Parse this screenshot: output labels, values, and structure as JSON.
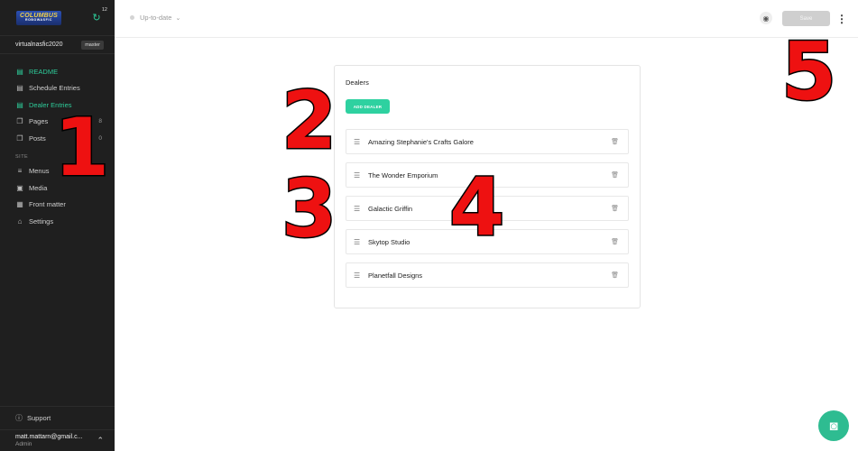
{
  "brand": {
    "line1": "COLUMBUS",
    "line2": "ROBOWASFIC"
  },
  "notifications": {
    "count": "12"
  },
  "site": {
    "name": "virtualnasfic2020",
    "branch": "master"
  },
  "sidebar": {
    "items": [
      {
        "label": "README",
        "count": "",
        "icon": "document-icon"
      },
      {
        "label": "Schedule Entries",
        "count": "",
        "icon": "document-icon"
      },
      {
        "label": "Dealer Entries",
        "count": "",
        "icon": "document-icon"
      },
      {
        "label": "Pages",
        "count": "8",
        "icon": "pages-icon"
      },
      {
        "label": "Posts",
        "count": "0",
        "icon": "pages-icon"
      }
    ],
    "section_label": "SITE",
    "site_items": [
      {
        "label": "Menus",
        "icon": "menu-icon"
      },
      {
        "label": "Media",
        "icon": "image-icon"
      },
      {
        "label": "Front matter",
        "icon": "front-matter-icon"
      },
      {
        "label": "Settings",
        "icon": "gear-icon"
      }
    ],
    "support_label": "Support",
    "user": {
      "email": "matt.mattarn@gmail.c...",
      "role": "Admin"
    }
  },
  "topbar": {
    "status": "Up-to-date",
    "save_label": "Save"
  },
  "main": {
    "title": "Dealers",
    "add_label": "ADD DEALER",
    "dealers": [
      "Amazing Stephanie's Crafts Galore",
      "The Wonder Emporium",
      "Galactic Griffin",
      "Skytop Studio",
      "Planetfall Designs"
    ]
  },
  "annotations": [
    "1",
    "2",
    "3",
    "4",
    "5"
  ],
  "colors": {
    "accent": "#2ed1a0",
    "sidebar_bg": "#1f1f1f",
    "annotation": "#ee1111"
  }
}
